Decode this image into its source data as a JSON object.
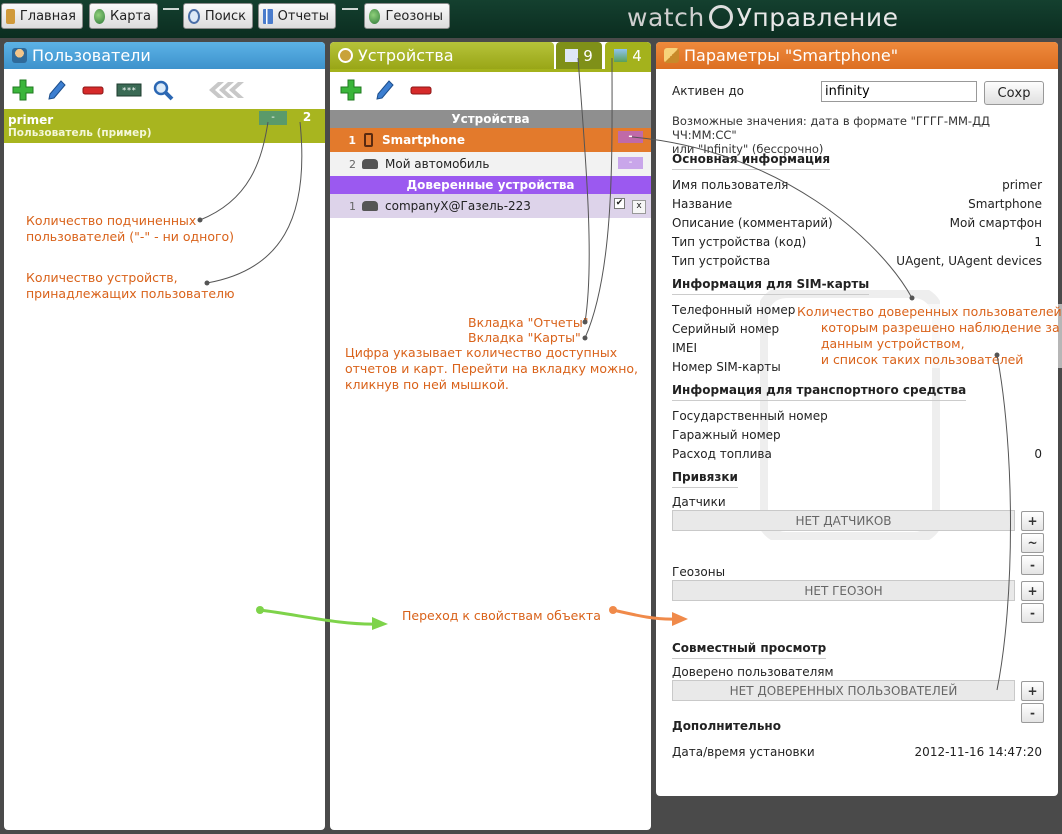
{
  "nav": {
    "home": "Главная",
    "map": "Карта",
    "search": "Поиск",
    "reports": "Отчеты",
    "geozones": "Геозоны"
  },
  "brand": {
    "part1": "watch",
    "part2": "Управление"
  },
  "users_panel": {
    "title": "Пользователи",
    "user": {
      "login": "primer",
      "description": "Пользователь (пример)",
      "subordinates": "-",
      "devices": "2"
    }
  },
  "devices_panel": {
    "title": "Устройства",
    "reports_count": "9",
    "maps_count": "4",
    "section_devices": "Устройства",
    "section_trusted": "Доверенные устройства",
    "devices": [
      {
        "num": "1",
        "name": "Smartphone",
        "badge": "-"
      },
      {
        "num": "2",
        "name": "Мой автомобиль",
        "badge": "-"
      }
    ],
    "trusted": [
      {
        "num": "1",
        "name": "companyX@Газель-223",
        "close": "x"
      }
    ]
  },
  "params_panel": {
    "title": "Параметры  \"Smartphone\"",
    "active_until_label": "Активен до",
    "active_until_value": "infinity",
    "save_button": "Сохр",
    "hint": "Возможные значения: дата в формате \"ГГГГ-ММ-ДД ЧЧ:ММ:СС\"\nили \"Infinity\" (бессрочно)",
    "basic_title": "Основная информация",
    "basic": [
      {
        "label": "Имя пользователя",
        "value": "primer"
      },
      {
        "label": "Название",
        "value": "Smartphone"
      },
      {
        "label": "Описание (комментарий)",
        "value": "Мой смартфон"
      },
      {
        "label": "Тип устройства (код)",
        "value": "1"
      },
      {
        "label": "Тип устройства",
        "value": "UAgent, UAgent devices"
      }
    ],
    "sim_title": "Информация для SIM-карты",
    "sim": [
      {
        "label": "Телефонный номер",
        "value": ""
      },
      {
        "label": "Серийный номер",
        "value": ""
      },
      {
        "label": "IMEI",
        "value": ""
      },
      {
        "label": "Номер SIM-карты",
        "value": ""
      }
    ],
    "vehicle_title": "Информация для транспортного средства",
    "vehicle": [
      {
        "label": "Государственный номер",
        "value": ""
      },
      {
        "label": "Гаражный номер",
        "value": ""
      },
      {
        "label": "Расход топлива",
        "value": "0"
      }
    ],
    "bindings_title": "Привязки",
    "sensors_label": "Датчики",
    "sensors_empty": "НЕТ ДАТЧИКОВ",
    "geozones_label": "Геозоны",
    "geozones_empty": "НЕТ ГЕОЗОН",
    "shared_title": "Совместный просмотр",
    "trusted_label": "Доверено пользователям",
    "trusted_empty": "НЕТ ДОВЕРЕННЫХ ПОЛЬЗОВАТЕЛЕЙ",
    "extra_title": "Дополнительно",
    "install_label": "Дата/время установки",
    "install_value": "2012-11-16 14:47:20",
    "btn_plus": "+",
    "btn_minus": "-",
    "btn_tilde": "~"
  },
  "annotations": {
    "subordinates": "Количество подчиненных\nпользователей (\"-\" - ни одного)",
    "devices_count": "Количество устройств,\nпринадлежащих пользователю",
    "reports_tab": "Вкладка \"Отчеты\"",
    "maps_tab": "Вкладка \"Карты\"",
    "tabs_hint": "Цифра указывает количество доступных\nотчетов и карт. Перейти на вкладку можно,\nкликнув по ней мышкой.",
    "trusted_users": "Количество доверенных пользователей,\n      которым разрешено наблюдение за\n      данным устройством,\n      и список таких пользователей",
    "goto_props": "Переход к свойствам объекта"
  },
  "colors": {
    "users_header": "#4aa3d9",
    "devices_header": "#a4b21c",
    "params_header": "#e37a2c",
    "selected_row": "#e37a2c",
    "trusted_header": "#9b59f0",
    "annotation": "#d9621a"
  }
}
